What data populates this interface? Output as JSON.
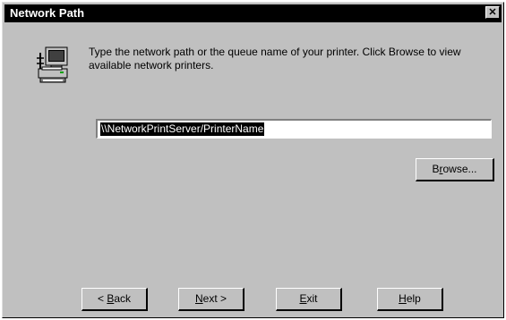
{
  "window": {
    "title": "Network Path",
    "close_glyph": "✕"
  },
  "icon": {
    "name": "network-printer-icon"
  },
  "message": "Type the network path or the queue name of your printer.  Click Browse to view available network printers.",
  "path_field": {
    "value": "\\\\NetworkPrintServer/PrinterName"
  },
  "buttons": {
    "browse": {
      "pre": "B",
      "key": "r",
      "post": "owse..."
    },
    "back": {
      "pre": "< ",
      "key": "B",
      "post": "ack"
    },
    "next": {
      "pre": "",
      "key": "N",
      "post": "ext >"
    },
    "exit": {
      "pre": "",
      "key": "E",
      "post": "xit"
    },
    "help": {
      "pre": "",
      "key": "H",
      "post": "elp"
    }
  }
}
